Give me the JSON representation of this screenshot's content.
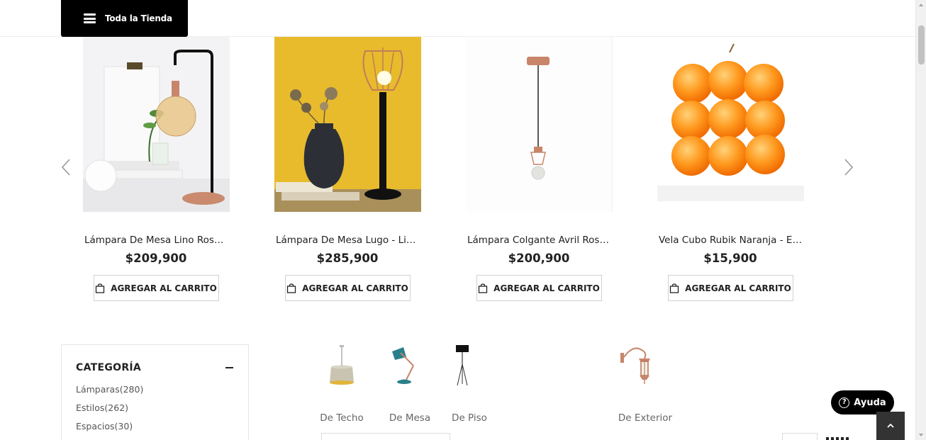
{
  "header": {
    "all_store_label": "Toda la Tienda"
  },
  "products": [
    {
      "name": "Lámpara De Mesa Lino Rose ...",
      "price": "$209,900",
      "cart_label": "AGREGAR AL CARRITO"
    },
    {
      "name": "Lámpara De Mesa Lugo - Lie...",
      "price": "$285,900",
      "cart_label": "AGREGAR AL CARRITO"
    },
    {
      "name": "Lámpara Colgante Avril Rose...",
      "price": "$200,900",
      "cart_label": "AGREGAR AL CARRITO"
    },
    {
      "name": "Vela Cubo Rubik Naranja - Eg...",
      "price": "$15,900",
      "cart_label": "AGREGAR AL CARRITO"
    }
  ],
  "sidebar": {
    "title": "CATEGORÍA",
    "categories": [
      {
        "label": "Lámparas(280)"
      },
      {
        "label": "Estilos(262)"
      },
      {
        "label": "Espacios(30)"
      }
    ]
  },
  "subcategories": [
    {
      "label": "De Techo"
    },
    {
      "label": "De Mesa"
    },
    {
      "label": "De Piso"
    },
    {
      "label": "De Exterior"
    }
  ],
  "help": {
    "label": "Ayuda"
  },
  "colors": {
    "header_bg": "#000000",
    "accent": "#222222",
    "copper": "#c8856a"
  }
}
